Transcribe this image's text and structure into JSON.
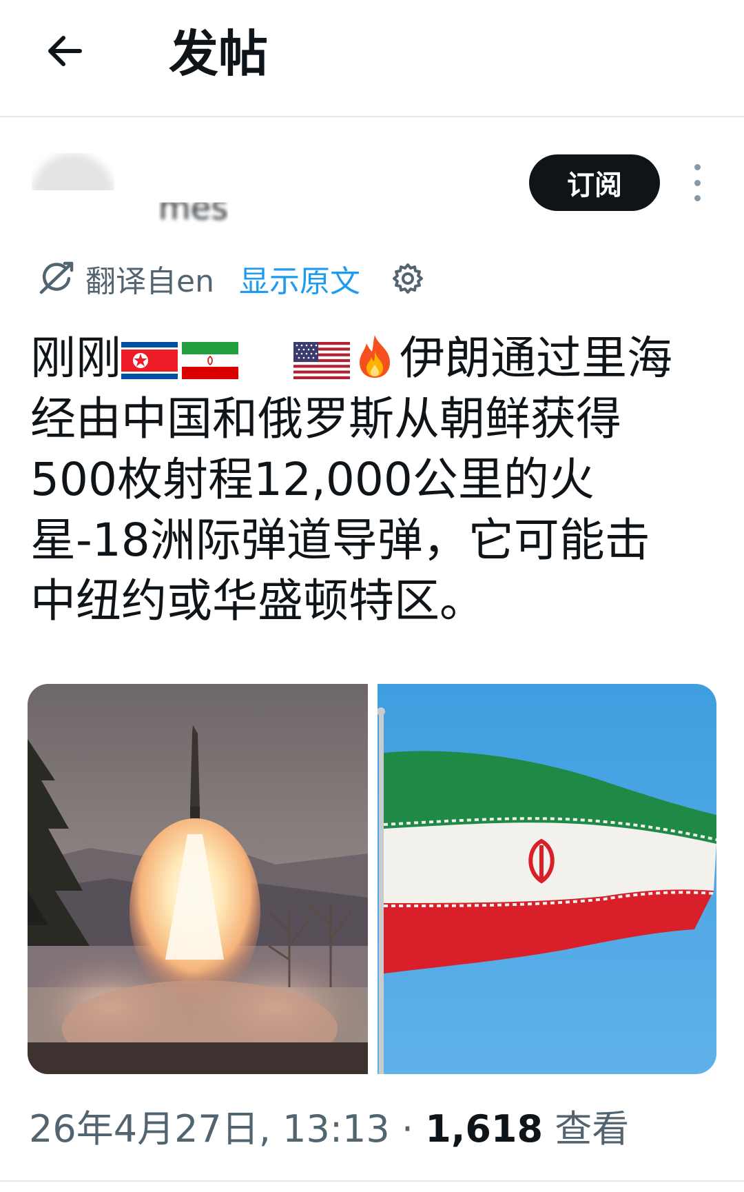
{
  "header": {
    "title": "发帖",
    "back_icon": "arrow-left-icon"
  },
  "author": {
    "name_visible_fragment": "mes",
    "subscribe_label": "订阅",
    "more_icon": "more-vertical-icon"
  },
  "translation": {
    "label": "翻译自en",
    "show_original": "显示原文",
    "translate_icon": "translate-icon",
    "settings_icon": "gear-icon",
    "link_color": "#1d9bf0"
  },
  "post": {
    "prefix": "刚刚",
    "emojis": [
      "north-korea-flag",
      "iran-flag",
      "usa-flag",
      "fire-emoji"
    ],
    "lead_text": "伊朗通过里",
    "body_text": "海经由中国和俄罗斯从朝鲜获得500枚射程12,000公里的火星-18洲际弹道导弹，它可能击中纽约或华盛顿特区。"
  },
  "media": [
    {
      "description_icon": "missile-launch-photo"
    },
    {
      "description_icon": "iran-flag-photo"
    }
  ],
  "meta": {
    "date_time": "26年4月27日, 13:13",
    "separator": "·",
    "views_count": "1,618",
    "views_label": "查看"
  }
}
